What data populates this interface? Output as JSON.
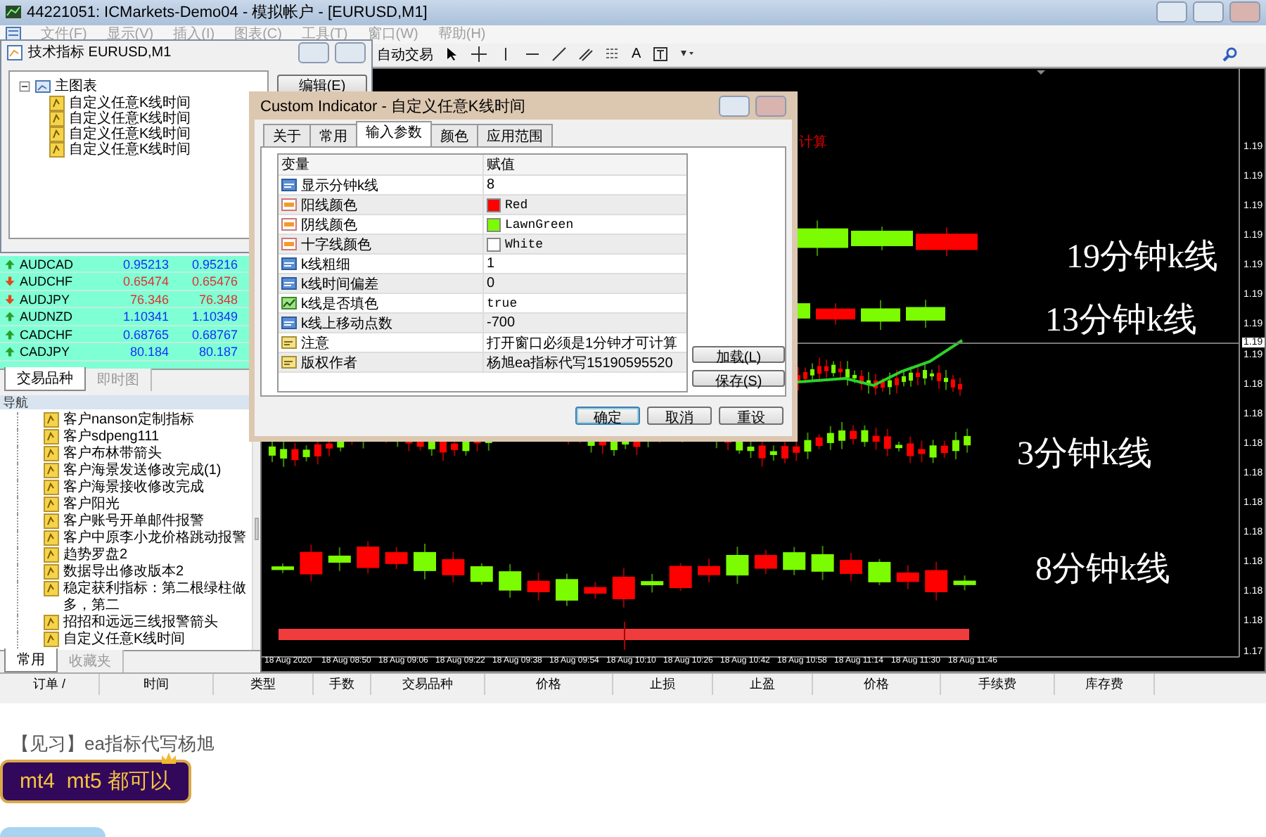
{
  "window": {
    "title": "44221051: ICMarkets-Demo04 - 模拟帐户 - [EURUSD,M1]"
  },
  "menu": [
    {
      "label": "文件(F)",
      "disabled": true
    },
    {
      "label": "显示(V)",
      "disabled": true
    },
    {
      "label": "插入(I)",
      "disabled": true
    },
    {
      "label": "图表(C)",
      "disabled": true
    },
    {
      "label": "工具(T)",
      "disabled": true
    },
    {
      "label": "窗口(W)",
      "disabled": true
    },
    {
      "label": "帮助(H)",
      "disabled": true
    }
  ],
  "toolbar": {
    "autotrade": "自动交易",
    "text_tool": "A"
  },
  "indicators_dialog": {
    "title": "技术指标 EURUSD,M1",
    "tree": [
      {
        "label": "主图表",
        "expanded": true,
        "children": [
          {
            "label": "自定义任意K线时间"
          },
          {
            "label": "自定义任意K线时间"
          },
          {
            "label": "自定义任意K线时间"
          },
          {
            "label": "自定义任意K线时间"
          }
        ]
      }
    ],
    "edit_button": "编辑(E)"
  },
  "market_watch": {
    "rows": [
      {
        "symbol": "AUDCAD",
        "bid": "0.95213",
        "ask": "0.95216",
        "up": true
      },
      {
        "symbol": "AUDCHF",
        "bid": "0.65474",
        "ask": "0.65476",
        "up": false
      },
      {
        "symbol": "AUDJPY",
        "bid": "76.346",
        "ask": "76.348",
        "up": false
      },
      {
        "symbol": "AUDNZD",
        "bid": "1.10341",
        "ask": "1.10349",
        "up": true
      },
      {
        "symbol": "CADCHF",
        "bid": "0.68765",
        "ask": "0.68767",
        "up": true
      },
      {
        "symbol": "CADJPY",
        "bid": "80.184",
        "ask": "80.187",
        "up": true
      }
    ],
    "tabs": [
      {
        "label": "交易品种",
        "selected": true
      },
      {
        "label": "即时图",
        "selected": false
      }
    ]
  },
  "navigator": {
    "title": "导航",
    "items": [
      "客户nanson定制指标",
      "客户sdpeng111",
      "客户布林带箭头",
      "客户海景发送修改完成(1)",
      "客户海景接收修改完成",
      "客户阳光",
      "客户账号开单邮件报警",
      "客户中原李小龙价格跳动报警",
      "趋势罗盘2",
      "数据导出修改版本2",
      "稳定获利指标：第二根绿柱做多，第二",
      "招招和远远三线报警箭头",
      "自定义任意K线时间"
    ],
    "tabs": [
      {
        "label": "常用",
        "selected": true
      },
      {
        "label": "收藏夹",
        "selected": false
      }
    ]
  },
  "chart": {
    "note": "计算",
    "labels": [
      "19分钟k线",
      "13分钟k线",
      "3分钟k线",
      "8分钟k线"
    ],
    "time_axis": [
      "18 Aug 2020",
      "18 Aug 08:50",
      "18 Aug 09:06",
      "18 Aug 09:22",
      "18 Aug 09:38",
      "18 Aug 09:54",
      "18 Aug 10:10",
      "18 Aug 10:26",
      "18 Aug 10:42",
      "18 Aug 10:58",
      "18 Aug 11:14",
      "18 Aug 11:30",
      "18 Aug 11:46"
    ],
    "price_axis": [
      "1.19",
      "1.19",
      "1.19",
      "1.19",
      "1.19",
      "1.19",
      "1.19",
      "1.19",
      "1.18",
      "1.18",
      "1.18",
      "1.18",
      "1.18",
      "1.18",
      "1.18",
      "1.18",
      "1.18",
      "1.17"
    ],
    "current_price": "1.19"
  },
  "custom_indicator_dialog": {
    "title": "Custom Indicator - 自定义任意K线时间",
    "tabs": [
      {
        "label": "关于",
        "selected": false
      },
      {
        "label": "常用",
        "selected": false
      },
      {
        "label": "输入参数",
        "selected": true
      },
      {
        "label": "颜色",
        "selected": false
      },
      {
        "label": "应用范围",
        "selected": false
      }
    ],
    "columns": [
      "变量",
      "赋值"
    ],
    "rows": [
      {
        "kind": "int",
        "name": "显示分钟k线",
        "value": "8"
      },
      {
        "kind": "color",
        "name": "阳线颜色",
        "value": "Red",
        "color": "#ff0000"
      },
      {
        "kind": "color",
        "name": "阴线颜色",
        "value": "LawnGreen",
        "color": "#7cfc00"
      },
      {
        "kind": "color",
        "name": "十字线颜色",
        "value": "White",
        "color": "#ffffff"
      },
      {
        "kind": "int",
        "name": "k线粗细",
        "value": "1"
      },
      {
        "kind": "int",
        "name": "k线时间偏差",
        "value": "0"
      },
      {
        "kind": "bool",
        "name": "k线是否填色",
        "value": "true"
      },
      {
        "kind": "int",
        "name": "k线上移动点数",
        "value": "-700"
      },
      {
        "kind": "string",
        "name": "注意",
        "value": "打开窗口必须是1分钟才可计算"
      },
      {
        "kind": "string",
        "name": "版权作者",
        "value": "杨旭ea指标代写15190595520"
      }
    ],
    "side_buttons": [
      "加载(L)",
      "保存(S)"
    ],
    "buttons": [
      "确定",
      "取消",
      "重设"
    ]
  },
  "terminal": {
    "columns": [
      "订单 /",
      "时间",
      "类型",
      "手数",
      "交易品种",
      "价格",
      "止损",
      "止盈",
      "价格",
      "手续费",
      "库存费"
    ]
  },
  "post": {
    "caption": "【见习】ea指标代写杨旭",
    "badge": "mt4  mt5 都可以"
  }
}
